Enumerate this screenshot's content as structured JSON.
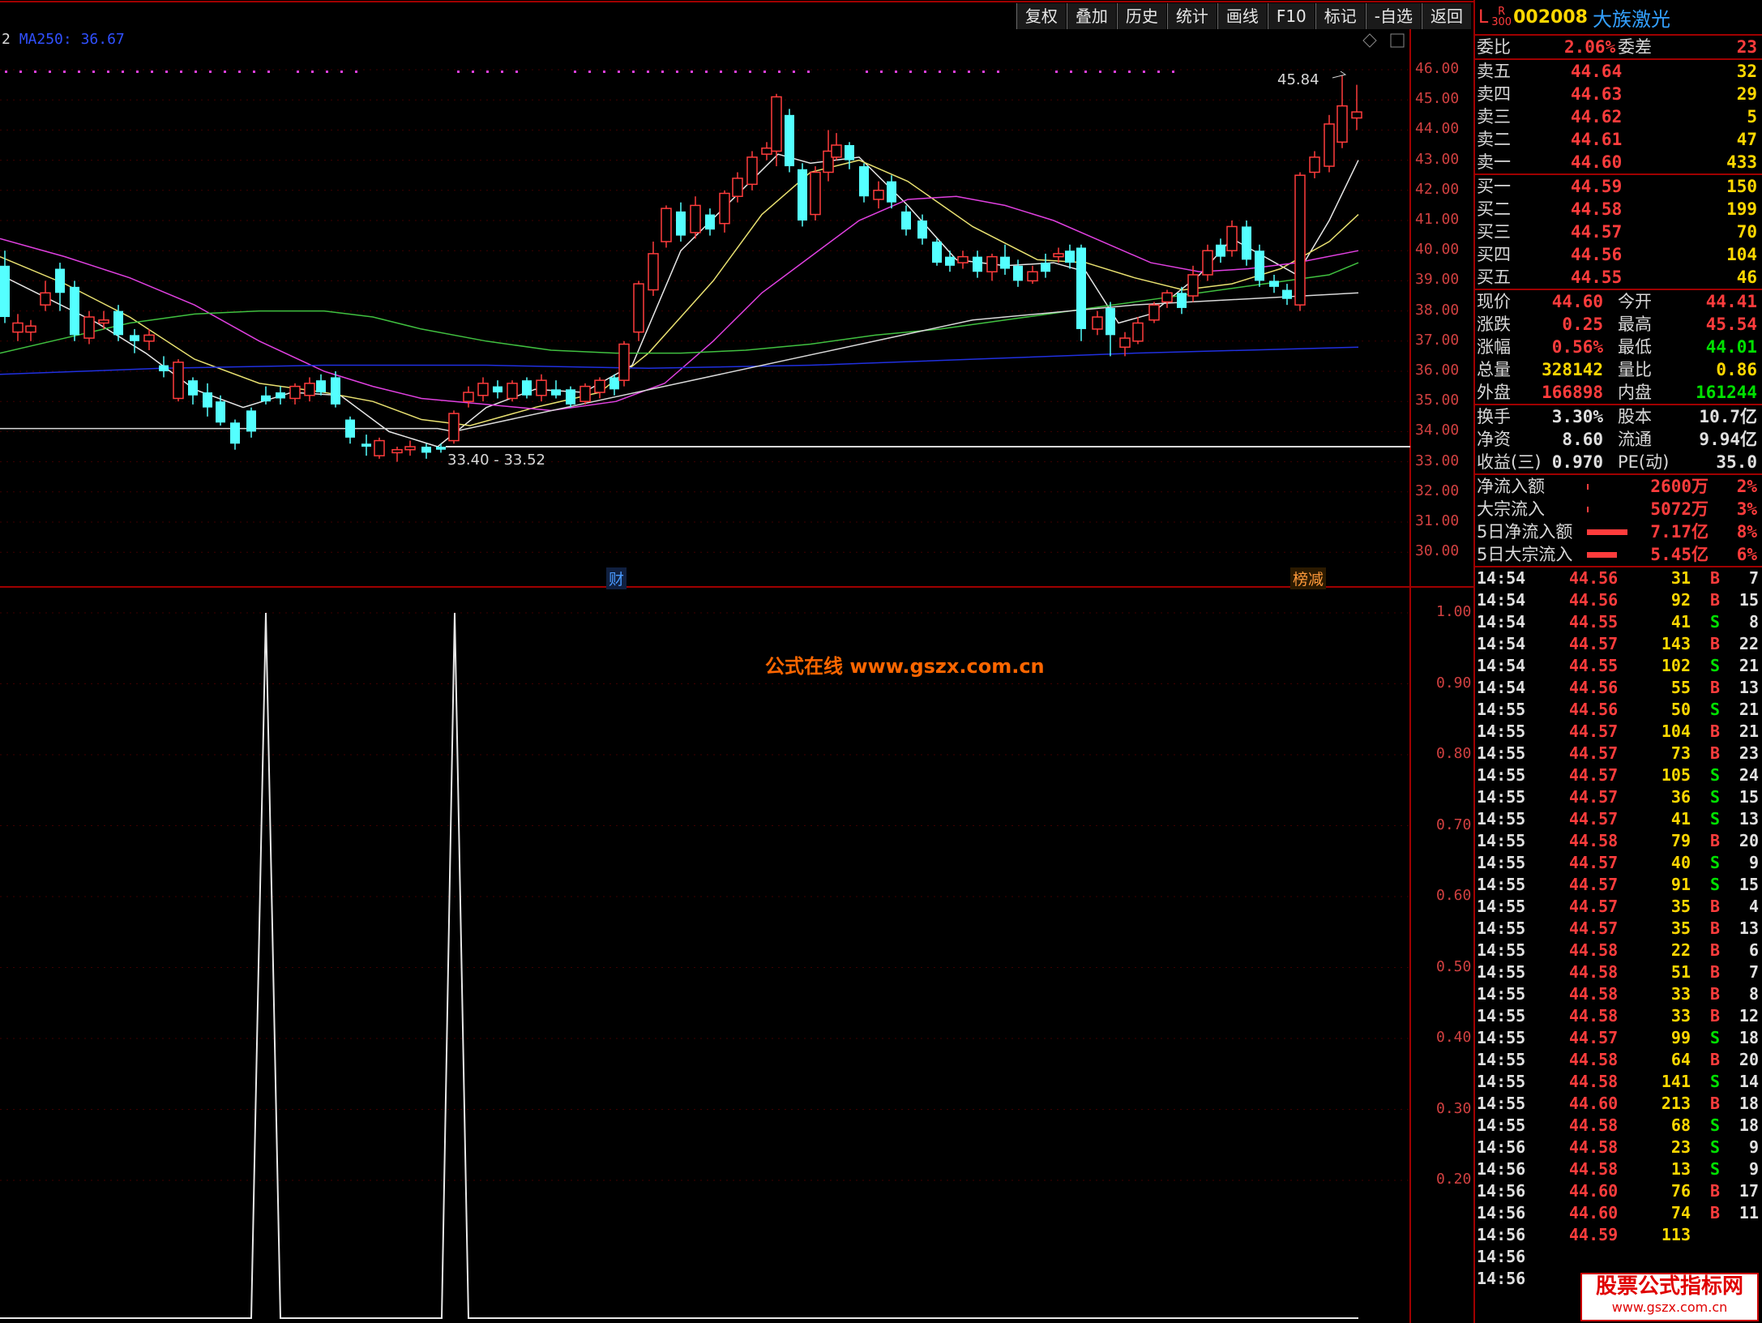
{
  "toolbar": [
    "复权",
    "叠加",
    "历史",
    "统计",
    "画线",
    "F10",
    "标记",
    "-自选",
    "返回"
  ],
  "ma_label": {
    "prefix": "2",
    "name": "MA250",
    "value": "36.67"
  },
  "price_axis": [
    "46.00",
    "45.00",
    "44.00",
    "43.00",
    "42.00",
    "41.00",
    "40.00",
    "39.00",
    "38.00",
    "37.00",
    "36.00",
    "35.00",
    "34.00",
    "33.00",
    "32.00",
    "31.00",
    "30.00"
  ],
  "ind_axis": [
    "1.00",
    "0.90",
    "0.80",
    "0.70",
    "0.60",
    "0.50",
    "0.40",
    "0.30",
    "0.20"
  ],
  "annotations": {
    "range": "33.40 - 33.52",
    "high": "45.84",
    "fin": "财",
    "fin2": "榜减"
  },
  "watermark": "公式在线  www.gszx.com.cn",
  "stock": {
    "L": "L",
    "R": "R",
    "R300": "300",
    "code": "002008",
    "name": "大族激光"
  },
  "weibi": {
    "label1": "委比",
    "value1": "2.06%",
    "label2": "委差",
    "value2": "23"
  },
  "sell": [
    {
      "label": "卖五",
      "price": "44.64",
      "vol": "32"
    },
    {
      "label": "卖四",
      "price": "44.63",
      "vol": "29"
    },
    {
      "label": "卖三",
      "price": "44.62",
      "vol": "5"
    },
    {
      "label": "卖二",
      "price": "44.61",
      "vol": "47"
    },
    {
      "label": "卖一",
      "price": "44.60",
      "vol": "433"
    }
  ],
  "buy": [
    {
      "label": "买一",
      "price": "44.59",
      "vol": "150"
    },
    {
      "label": "买二",
      "price": "44.58",
      "vol": "199"
    },
    {
      "label": "买三",
      "price": "44.57",
      "vol": "70"
    },
    {
      "label": "买四",
      "price": "44.56",
      "vol": "104"
    },
    {
      "label": "买五",
      "price": "44.55",
      "vol": "46"
    }
  ],
  "quote": [
    {
      "l1": "现价",
      "v1": "44.60",
      "c1": "red",
      "l2": "今开",
      "v2": "44.41",
      "c2": "red"
    },
    {
      "l1": "涨跌",
      "v1": "0.25",
      "c1": "red",
      "l2": "最高",
      "v2": "45.54",
      "c2": "red"
    },
    {
      "l1": "涨幅",
      "v1": "0.56%",
      "c1": "red",
      "l2": "最低",
      "v2": "44.01",
      "c2": "grn"
    },
    {
      "l1": "总量",
      "v1": "328142",
      "c1": "yel",
      "l2": "量比",
      "v2": "0.86",
      "c2": "yel"
    },
    {
      "l1": "外盘",
      "v1": "166898",
      "c1": "red",
      "l2": "内盘",
      "v2": "161244",
      "c2": "grn"
    }
  ],
  "fund": [
    {
      "l1": "换手",
      "v1": "3.30%",
      "l2": "股本",
      "v2": "10.7亿"
    },
    {
      "l1": "净资",
      "v1": "8.60",
      "l2": "流通",
      "v2": "9.94亿"
    },
    {
      "l1": "收益(三)",
      "v1": "0.970",
      "l2": "PE(动)",
      "v2": "35.0"
    }
  ],
  "flow": [
    {
      "label": "净流入额",
      "value": "2600万",
      "pct": "2%",
      "bar": 0.02
    },
    {
      "label": "大宗流入",
      "value": "5072万",
      "pct": "3%",
      "bar": 0.03
    },
    {
      "label": "5日净流入额",
      "value": "7.17亿",
      "pct": "8%",
      "bar": 0.8
    },
    {
      "label": "5日大宗流入",
      "value": "5.45亿",
      "pct": "6%",
      "bar": 0.6
    }
  ],
  "ticks": [
    [
      "14:54",
      "44.56",
      "31",
      "B",
      "7"
    ],
    [
      "14:54",
      "44.56",
      "92",
      "B",
      "15"
    ],
    [
      "14:54",
      "44.55",
      "41",
      "S",
      "8"
    ],
    [
      "14:54",
      "44.57",
      "143",
      "B",
      "22"
    ],
    [
      "14:54",
      "44.55",
      "102",
      "S",
      "21"
    ],
    [
      "14:54",
      "44.56",
      "55",
      "B",
      "13"
    ],
    [
      "14:55",
      "44.56",
      "50",
      "S",
      "21"
    ],
    [
      "14:55",
      "44.57",
      "104",
      "B",
      "21"
    ],
    [
      "14:55",
      "44.57",
      "73",
      "B",
      "23"
    ],
    [
      "14:55",
      "44.57",
      "105",
      "S",
      "24"
    ],
    [
      "14:55",
      "44.57",
      "36",
      "S",
      "15"
    ],
    [
      "14:55",
      "44.57",
      "41",
      "S",
      "13"
    ],
    [
      "14:55",
      "44.58",
      "79",
      "B",
      "20"
    ],
    [
      "14:55",
      "44.57",
      "40",
      "S",
      "9"
    ],
    [
      "14:55",
      "44.57",
      "91",
      "S",
      "15"
    ],
    [
      "14:55",
      "44.57",
      "35",
      "B",
      "4"
    ],
    [
      "14:55",
      "44.57",
      "35",
      "B",
      "13"
    ],
    [
      "14:55",
      "44.58",
      "22",
      "B",
      "6"
    ],
    [
      "14:55",
      "44.58",
      "51",
      "B",
      "7"
    ],
    [
      "14:55",
      "44.58",
      "33",
      "B",
      "8"
    ],
    [
      "14:55",
      "44.58",
      "33",
      "B",
      "12"
    ],
    [
      "14:55",
      "44.57",
      "99",
      "S",
      "18"
    ],
    [
      "14:55",
      "44.58",
      "64",
      "B",
      "20"
    ],
    [
      "14:55",
      "44.58",
      "141",
      "S",
      "14"
    ],
    [
      "14:55",
      "44.60",
      "213",
      "B",
      "18"
    ],
    [
      "14:55",
      "44.58",
      "68",
      "S",
      "18"
    ],
    [
      "14:56",
      "44.58",
      "23",
      "S",
      "9"
    ],
    [
      "14:56",
      "44.58",
      "13",
      "S",
      "9"
    ],
    [
      "14:56",
      "44.60",
      "76",
      "B",
      "17"
    ],
    [
      "14:56",
      "44.60",
      "74",
      "B",
      "11"
    ],
    [
      "14:56",
      "44.59",
      "113",
      "",
      ""
    ],
    [
      "14:56",
      "",
      "",
      "",
      ""
    ],
    [
      "14:56",
      "",
      "",
      "",
      ""
    ]
  ],
  "logo": {
    "line1": "股票公式指标网",
    "line2": "www.gszx.com.cn"
  }
}
